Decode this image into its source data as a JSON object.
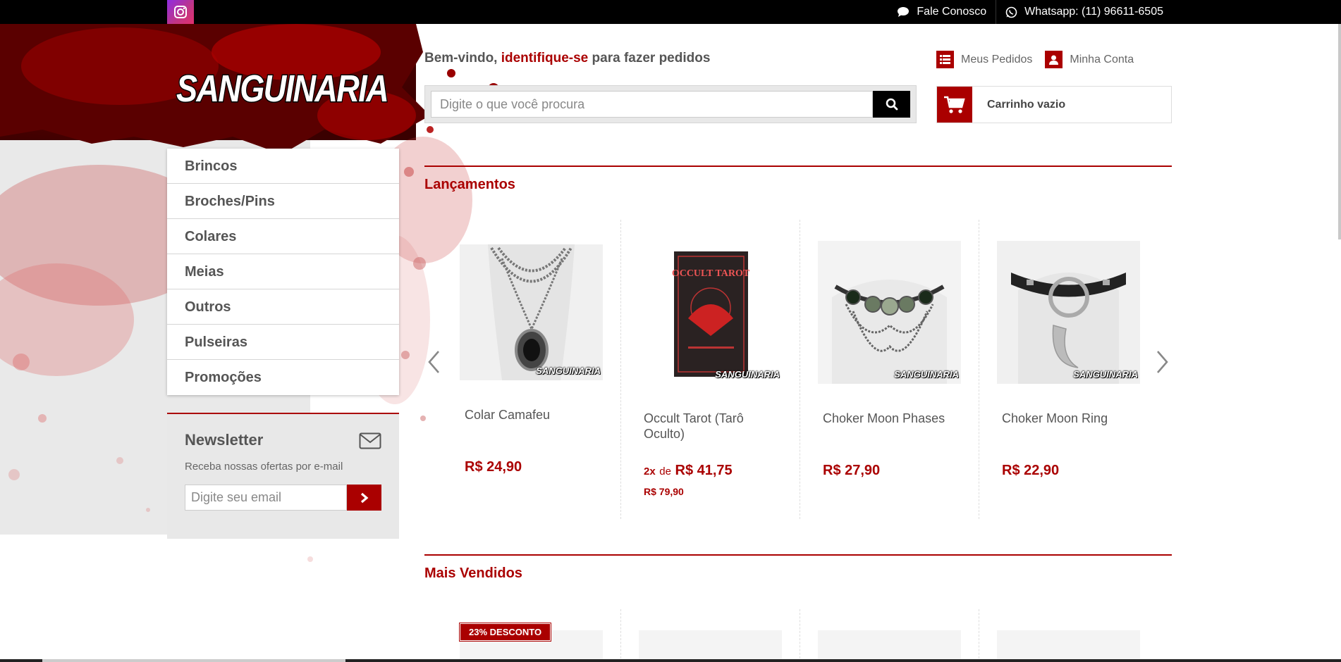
{
  "topbar": {
    "contact_label": "Fale Conosco",
    "whatsapp_label": "Whatsapp: (11) 96611-6505"
  },
  "header": {
    "logo_text": "SANGUINARIA",
    "welcome_prefix": "Bem-vindo,",
    "welcome_link": "identifique-se",
    "welcome_suffix": "para fazer pedidos",
    "search_placeholder": "Digite o que você procura",
    "my_orders": "Meus Pedidos",
    "my_account": "Minha Conta",
    "cart_label": "Carrinho vazio"
  },
  "sidebar": {
    "categories": [
      {
        "label": "Brincos"
      },
      {
        "label": "Broches/Pins"
      },
      {
        "label": "Colares"
      },
      {
        "label": "Meias"
      },
      {
        "label": "Outros"
      },
      {
        "label": "Pulseiras"
      },
      {
        "label": "Promoções"
      }
    ],
    "newsletter": {
      "title": "Newsletter",
      "description": "Receba nossas ofertas por e-mail",
      "placeholder": "Digite seu email"
    }
  },
  "main": {
    "section1_title": "Lançamentos",
    "section2_title": "Mais Vendidos",
    "watermark": "SANGUINARIA",
    "products": [
      {
        "name": "Colar Camafeu",
        "price": "R$ 24,90"
      },
      {
        "name": "Occult Tarot (Tarô Oculto)",
        "installments_qty": "2x",
        "installments_de": "de",
        "price": "R$ 41,75",
        "full_price": "R$ 79,90",
        "box_title": "OCCULT TAROT"
      },
      {
        "name": "Choker Moon Phases",
        "price": "R$ 27,90"
      },
      {
        "name": "Choker Moon Ring",
        "price": "R$ 22,90"
      }
    ],
    "best_seller_badge": "23% DESCONTO"
  },
  "colors": {
    "accent": "#aa0000",
    "topbar": "#000000",
    "panel": "#e8e8e8"
  }
}
